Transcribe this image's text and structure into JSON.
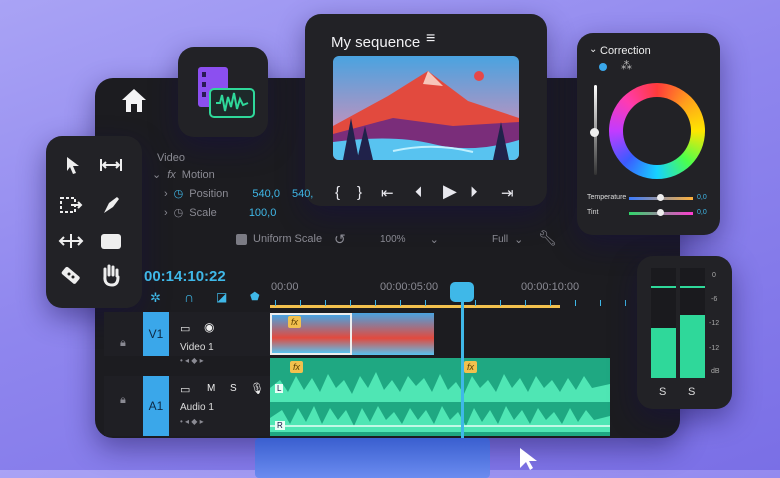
{
  "sequence": {
    "title": "My sequence",
    "menu_icon": "hamburger-icon"
  },
  "correction": {
    "title": "Correction",
    "temperature_label": "Temperature",
    "temperature_value": "0,0",
    "tint_label": "Tint",
    "tint_value": "0,0"
  },
  "effects": {
    "video_label": "Video",
    "motion_label": "Motion",
    "position_label": "Position",
    "position_x": "540,0",
    "position_y": "540,",
    "scale_label": "Scale",
    "scale_value": "100,0",
    "uniform_scale_label": "Uniform Scale",
    "zoom_value": "100%",
    "quality_value": "Full"
  },
  "timeline": {
    "timecode": "00:14:10:22",
    "ruler": [
      "00:00",
      "00:00:05:00",
      "00:00:10:00"
    ],
    "video_track": {
      "id": "V1",
      "name": "Video 1"
    },
    "audio_track": {
      "id": "A1",
      "name": "Audio 1",
      "mute": "M",
      "solo": "S"
    },
    "channel_left": "L",
    "channel_right": "R",
    "fx_badge": "fx",
    "playhead_time_fraction": 0.38
  },
  "meter": {
    "scale": [
      "0",
      "-6",
      "-12",
      "-12",
      "dB"
    ],
    "left_label": "S",
    "right_label": "S",
    "left_level": 0.55,
    "right_level": 0.7
  },
  "colors": {
    "accent": "#3fb8e8",
    "audio": "#2fd89a",
    "clip_badge": "#f2c14e",
    "media_icon": "#9b5cf6"
  }
}
